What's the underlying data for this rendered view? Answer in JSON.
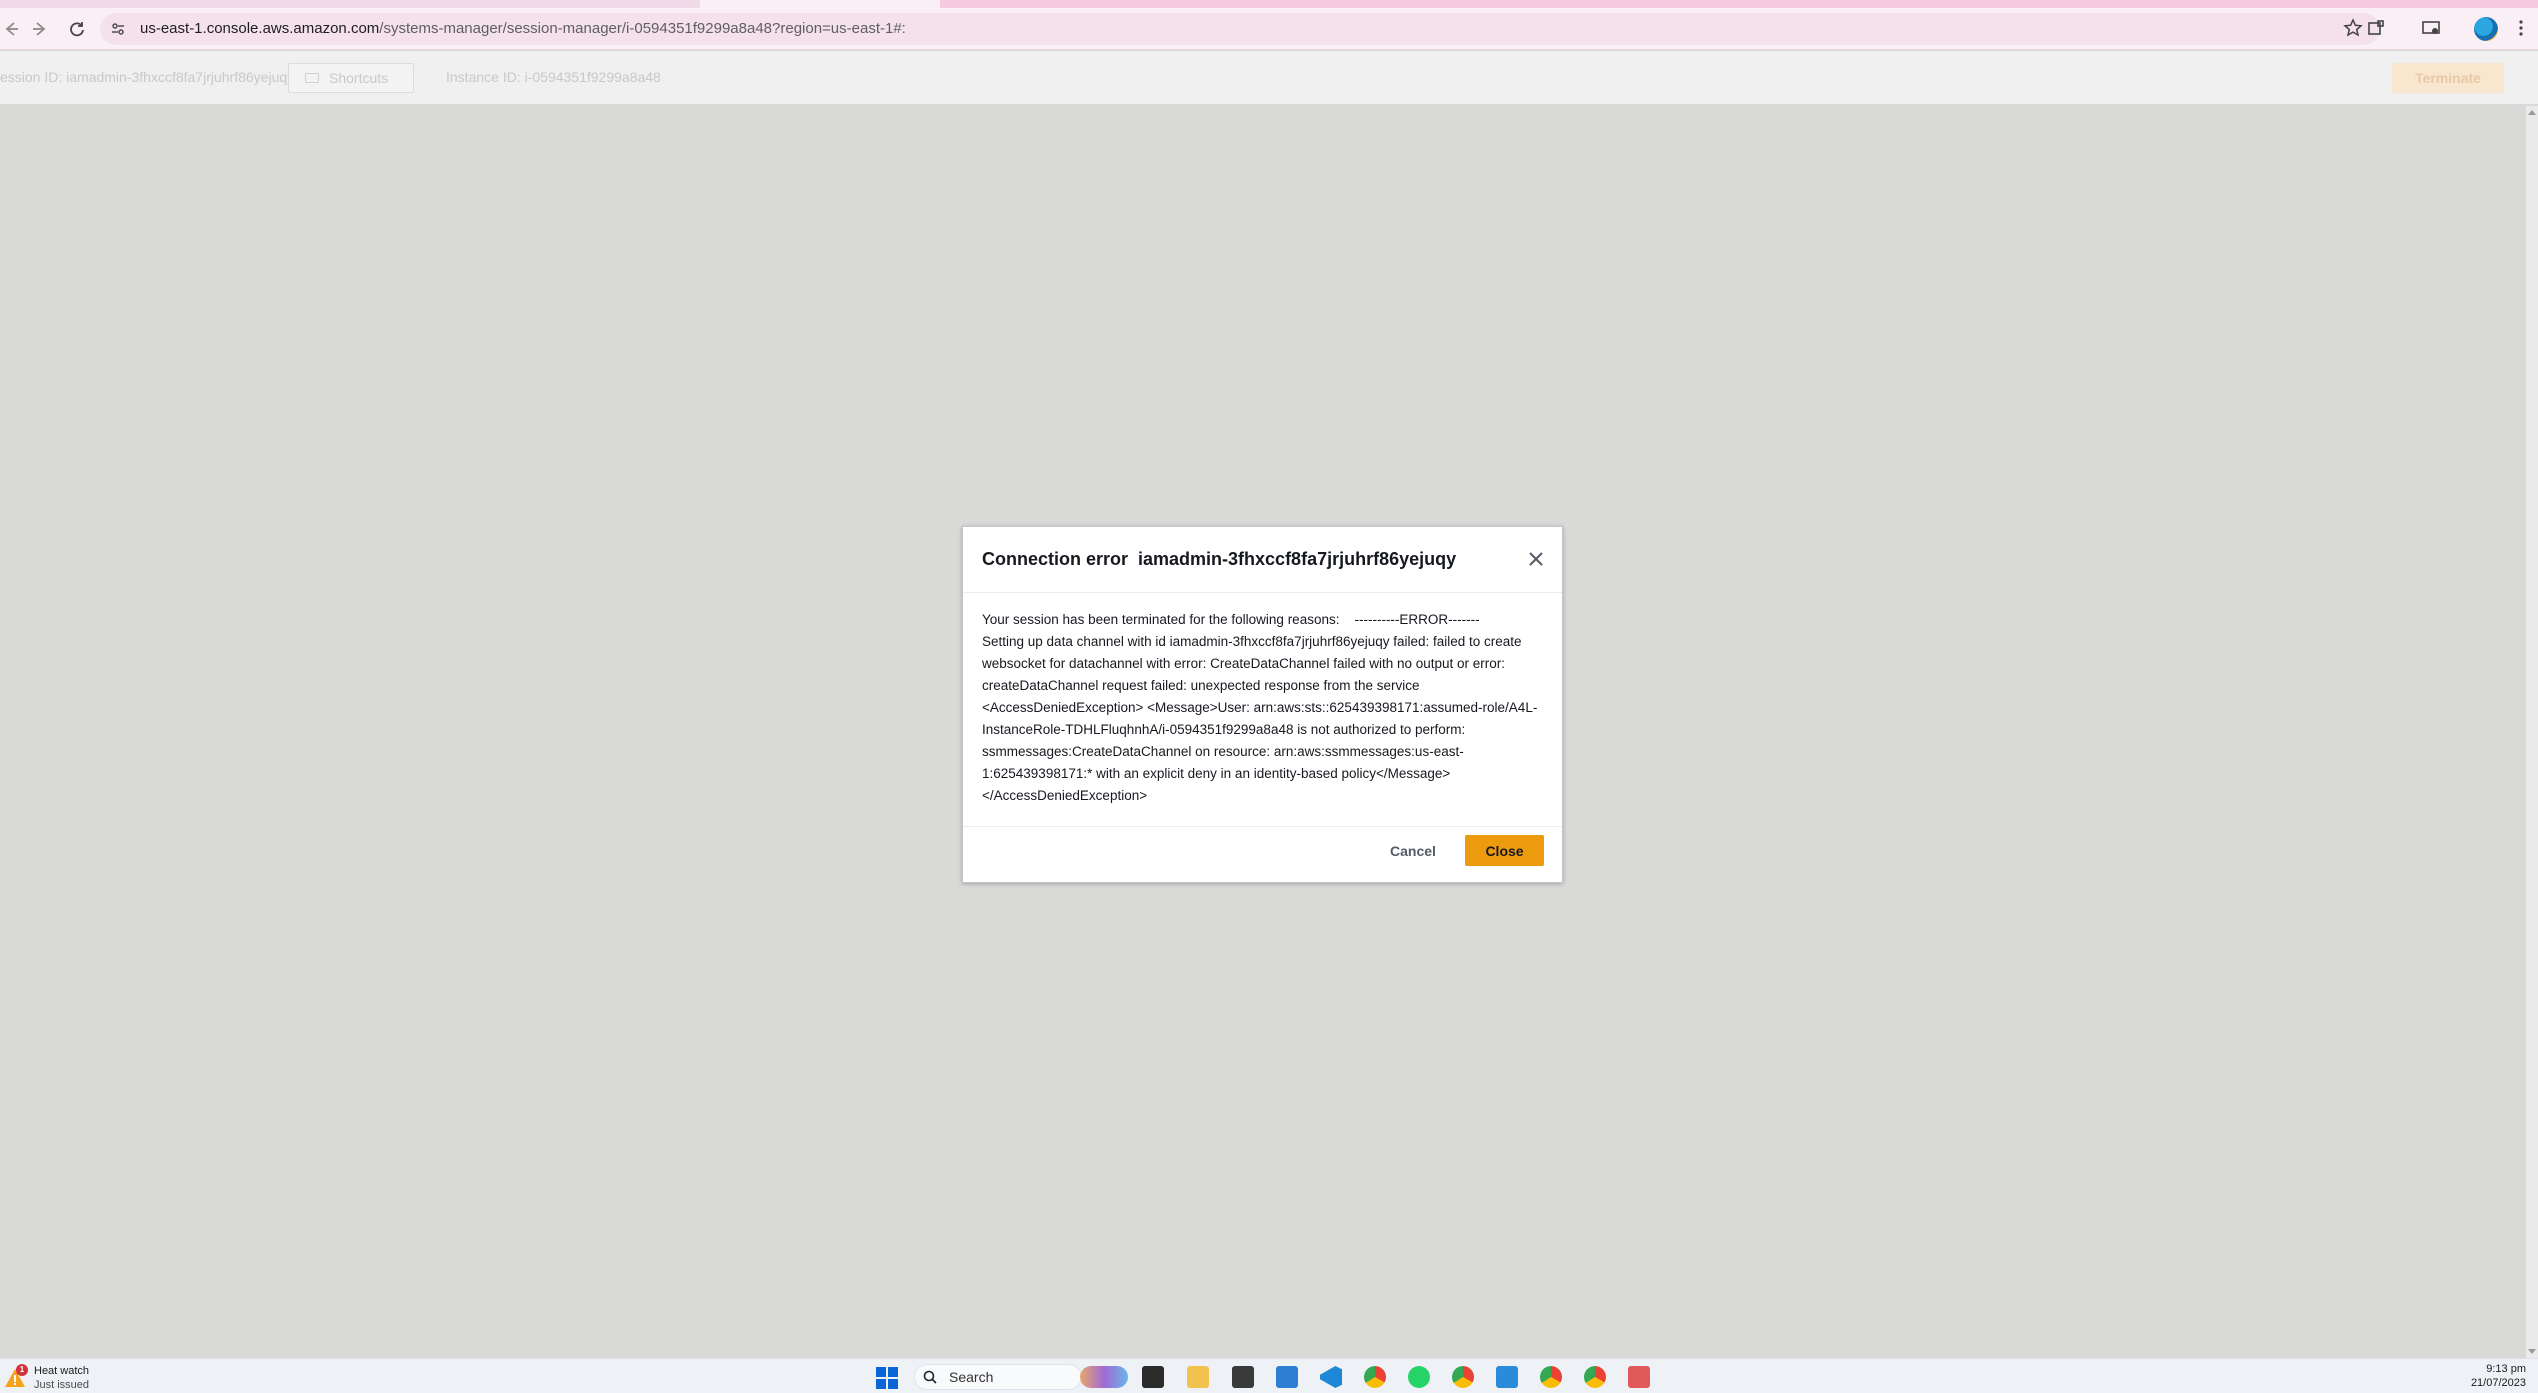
{
  "browser": {
    "url_host": "us-east-1.console.aws.amazon.com",
    "url_path": "/systems-manager/session-manager/i-0594351f9299a8a48?region=us-east-1#:",
    "back_icon": "arrow-left-icon",
    "forward_icon": "arrow-right-icon",
    "reload_icon": "reload-icon"
  },
  "session_bar": {
    "session_id": "ession ID: iamadmin-3fhxccf8fa7jrjuhrf86yejuqy",
    "shortcuts_label": "Shortcuts",
    "instance_id": "Instance ID: i-0594351f9299a8a48",
    "terminate_label": "Terminate"
  },
  "modal": {
    "title": "Connection error  iamadmin-3fhxccf8fa7jrjuhrf86yejuqy",
    "body": "Your session has been terminated for the following reasons:    ----------ERROR-------\nSetting up data channel with id iamadmin-3fhxccf8fa7jrjuhrf86yejuqy failed: failed to create websocket for datachannel with error: CreateDataChannel failed with no output or error: createDataChannel request failed: unexpected response from the service <AccessDeniedException> <Message>User: arn:aws:sts::625439398171:assumed-role/A4L-InstanceRole-TDHLFluqhnhA/i-0594351f9299a8a48 is not authorized to perform: ssmmessages:CreateDataChannel on resource: arn:aws:ssmmessages:us-east-1:625439398171:* with an explicit deny in an identity-based policy</Message>\n</AccessDeniedException>",
    "cancel_label": "Cancel",
    "close_label": "Close"
  },
  "taskbar": {
    "weather_title": "Heat watch",
    "weather_subtitle": "Just issued",
    "weather_badge": "1",
    "search_label": "Search",
    "time": "9:13 pm",
    "date": "21/07/2023"
  },
  "colors": {
    "accent_orange": "#ec9a0e",
    "overlay": "#d9d9d8",
    "chrome_pink": "#fbeff6"
  }
}
